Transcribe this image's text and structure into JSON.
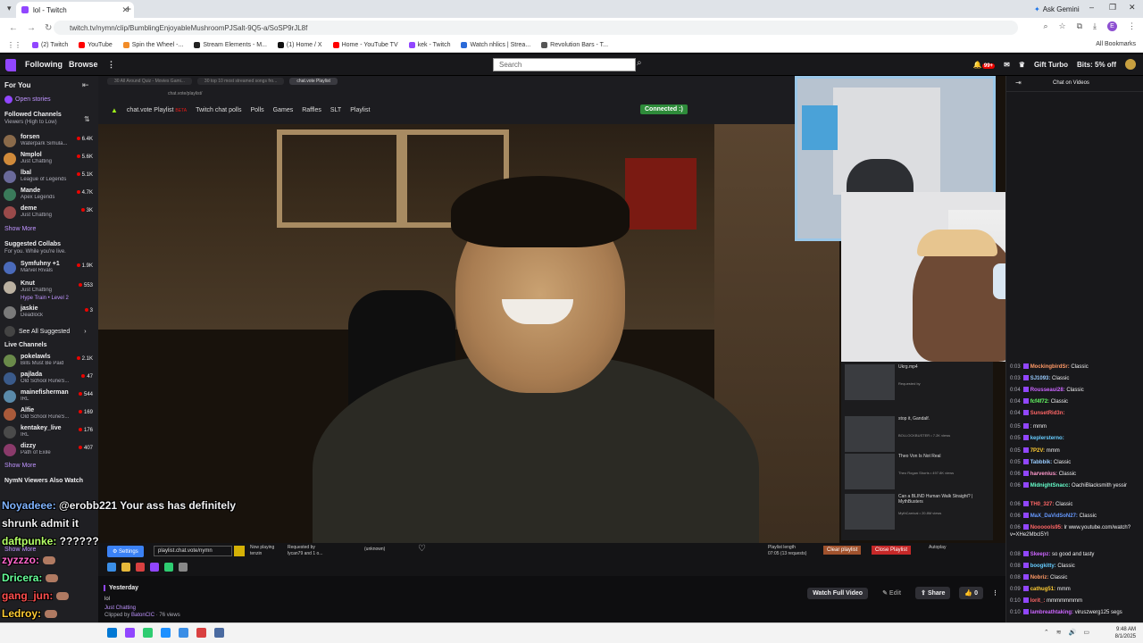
{
  "browser": {
    "tab_title": "lol - Twitch",
    "url": "twitch.tv/nymn/clip/BumblingEnjoyableMushroomPJSalt-9Q5-a/SoSP9rJL8f",
    "ask_label": "Ask Gemini",
    "all_bookmarks": "All Bookmarks",
    "bookmarks": [
      {
        "label": "(2) Twitch",
        "color": "#9146ff"
      },
      {
        "label": "YouTube",
        "color": "#ff0000"
      },
      {
        "label": "Spin the Wheel -...",
        "color": "#f28c28"
      },
      {
        "label": "Stream Elements - M...",
        "color": "#222222"
      },
      {
        "label": "(1) Home / X",
        "color": "#111111"
      },
      {
        "label": "Home - YouTube TV",
        "color": "#ff0000"
      },
      {
        "label": "kek - Twitch",
        "color": "#9146ff"
      },
      {
        "label": "Watch nhlics | Strea...",
        "color": "#2a6ad8"
      },
      {
        "label": "Revolution Bars - T...",
        "color": "#555555"
      }
    ]
  },
  "twitch_nav": {
    "following": "Following",
    "browse": "Browse",
    "search_placeholder": "Search",
    "gift_turbo": "Gift Turbo",
    "bits_offer": "Bits: 5% off",
    "notif_badge": "99+"
  },
  "sidebar": {
    "for_you": "For You",
    "open_stories": "Open stories",
    "followed_title": "Followed Channels",
    "followed_sub": "Viewers (High to Low)",
    "followed": [
      {
        "name": "forsen",
        "game": "Waterpark Simula...",
        "viewers": "6.4K",
        "color": "#8a6a4a"
      },
      {
        "name": "Nmplol",
        "game": "Just Chatting",
        "viewers": "5.6K",
        "color": "#d08a3a"
      },
      {
        "name": "lbal",
        "game": "League of Legends",
        "viewers": "5.1K",
        "color": "#6a6a9a"
      },
      {
        "name": "Mande",
        "game": "Apex Legends",
        "viewers": "4.7K",
        "color": "#3a7a5a"
      },
      {
        "name": "deme",
        "game": "Just Chatting",
        "viewers": "3K",
        "color": "#9a4a4a"
      }
    ],
    "show_more": "Show More",
    "suggested_title": "Suggested Collabs",
    "suggested_sub": "For you. While you're live.",
    "suggested": [
      {
        "name": "Symfuhny +1",
        "game": "Marvel Rivals",
        "viewers": "1.9K",
        "color": "#4a6aba"
      },
      {
        "name": "Knut",
        "game": "Just Chatting",
        "viewers": "553",
        "color": "#bab0a0"
      },
      {
        "name": "Hype Train • Level 2",
        "game": "",
        "viewers": "",
        "color": "#6a3aba"
      },
      {
        "name": "jaskie",
        "game": "Deadlock",
        "viewers": "3",
        "color": "#7a7a7a"
      }
    ],
    "see_all": "See All Suggested",
    "live_title": "Live Channels",
    "live": [
      {
        "name": "pokelawls",
        "game": "Bills Must Be Paid",
        "viewers": "2.1K",
        "color": "#6a8a4a"
      },
      {
        "name": "pajlada",
        "game": "Old School RuneS...",
        "viewers": "47",
        "color": "#3a5a8a"
      },
      {
        "name": "mainefisherman",
        "game": "IRL",
        "viewers": "544",
        "color": "#5a8aaa"
      },
      {
        "name": "Alfie",
        "game": "Old School RuneS...",
        "viewers": "169",
        "color": "#aa5a3a"
      },
      {
        "name": "kentakey_live",
        "game": "IRL",
        "viewers": "176",
        "color": "#4a4a4a"
      },
      {
        "name": "dizzy",
        "game": "Path of Exile",
        "viewers": "407",
        "color": "#8a3a6a"
      }
    ],
    "also_watch": "NymN Viewers Also Watch"
  },
  "overlay_chat": [
    {
      "user": "Noyadeee:",
      "color": "#7fb3ff",
      "text": " @erobb221 Your ass has definitely"
    },
    {
      "user": "",
      "color": "#ffffff",
      "text": "shrunk admit it"
    },
    {
      "user": "daftpunke:",
      "color": "#b3ff66",
      "text": " ??????"
    },
    {
      "user": "zyzzzo:",
      "color": "#ff66cc",
      "text": ""
    },
    {
      "user": "Dricera:",
      "color": "#66ff99",
      "text": ""
    },
    {
      "user": "gang_jun:",
      "color": "#ff4d4d",
      "text": ""
    },
    {
      "user": "Ledroy:",
      "color": "#ffcc33",
      "text": ""
    }
  ],
  "video": {
    "inner_tabs": [
      "30 All Around Quiz - Movies Gami...",
      "30 top 10 most streamed songs fro...",
      "chat.vote Playlist"
    ],
    "inner_url": "chat.vote/playlist/",
    "app_title": "chat.vote Playlist",
    "beta": "BETA",
    "nav": [
      "Twitch chat polls",
      "Polls",
      "Games",
      "Raffles",
      "SLT",
      "Playlist"
    ],
    "connected": "Connected :)",
    "playlist": [
      {
        "title": "Ukrg.mp4",
        "sub": "Requested by"
      },
      {
        "title": "stop it, Gandalf.",
        "sub": "BOLLOCKBUSTER • 7.2K views"
      },
      {
        "title": "Theo Von Is Not Real",
        "sub": "Theo Rogan Shorts • 497.8K views"
      },
      {
        "title": "Can a BLIND Human Walk Straight? | MythBusters",
        "sub": "MythCarrical • 20.8M views"
      }
    ],
    "settings": "Settings",
    "playlist_url": "playlist.chat.vote/nymn",
    "now_playing_label": "Now playing",
    "now_playing": "tenzin",
    "requested_label": "Requested by",
    "requested": "lycan79 and 1 o...",
    "unknown": "(unknown)",
    "pl_length_label": "Playlist length",
    "pl_length": "07:05 (13 requests)",
    "clear_playlist": "Clear playlist",
    "close_playlist": "Close Playlist",
    "autoplay": "Autoplay"
  },
  "clip": {
    "date": "Yesterday",
    "title": "lol",
    "category": "Just Chatting",
    "clipped_by_label": "Clipped by ",
    "clipped_by": "BatonCIC",
    "views": " · 76 views",
    "watch_full": "Watch Full Video",
    "edit": "Edit",
    "share": "Share",
    "likes": "0"
  },
  "chat": {
    "title": "Chat on Videos",
    "messages": [
      {
        "time": "0:03",
        "user": "MockingbirdSr:",
        "color": "#ff9966",
        "text": " Classic"
      },
      {
        "time": "0:03",
        "user": "SJ1093:",
        "color": "#99ccff",
        "text": " Classic"
      },
      {
        "time": "0:04",
        "user": "Rousseaui28:",
        "color": "#cc66ff",
        "text": " Classic"
      },
      {
        "time": "0:04",
        "user": "fcf4f72:",
        "color": "#66ff66",
        "text": " Classic"
      },
      {
        "time": "0:04",
        "user": "SunsetRid3n:",
        "color": "#ff6666",
        "text": ""
      },
      {
        "time": "0:05",
        "user": "",
        "color": "#ffffff",
        "text": ": mmm"
      },
      {
        "time": "0:05",
        "user": "keplersterno:",
        "color": "#66ccff",
        "text": ""
      },
      {
        "time": "0:05",
        "user": "7P2V:",
        "color": "#ffcc33",
        "text": " mmm"
      },
      {
        "time": "0:05",
        "user": "Tabbbik:",
        "color": "#99ccff",
        "text": " Classic"
      },
      {
        "time": "0:06",
        "user": "harvenius:",
        "color": "#ff99cc",
        "text": " Classic"
      },
      {
        "time": "0:06",
        "user": "MidnightSnacc:",
        "color": "#66ffcc",
        "text": " OachiBlacksmith yessir"
      },
      {
        "time": "0:06",
        "user": "TH0_327:",
        "color": "#ff6666",
        "text": " Classic"
      },
      {
        "time": "0:06",
        "user": "MaX_DaVidSoN27:",
        "color": "#6699ff",
        "text": " Classic"
      },
      {
        "time": "0:06",
        "user": "Noooools95:",
        "color": "#ff6666",
        "text": " lr www.youtube.com/watch?v=XHe2MbcI5YI"
      },
      {
        "time": "0:08",
        "user": "Skeepz:",
        "color": "#cc66ff",
        "text": " so good and tasty"
      },
      {
        "time": "0:08",
        "user": "boogkitty:",
        "color": "#66ccff",
        "text": " Classic"
      },
      {
        "time": "0:08",
        "user": "Nobriz:",
        "color": "#ff9966",
        "text": " Classic"
      },
      {
        "time": "0:09",
        "user": "cathug51:",
        "color": "#ffcc33",
        "text": " mmm"
      },
      {
        "time": "0:10",
        "user": "lorit_:",
        "color": "#ff6666",
        "text": " mmmmmmmm"
      },
      {
        "time": "0:10",
        "user": "lambreathtaking:",
        "color": "#cc66ff",
        "text": " viruszwerg125 segs"
      }
    ]
  },
  "os": {
    "time": "9:48 AM",
    "date": "8/1/2025"
  }
}
